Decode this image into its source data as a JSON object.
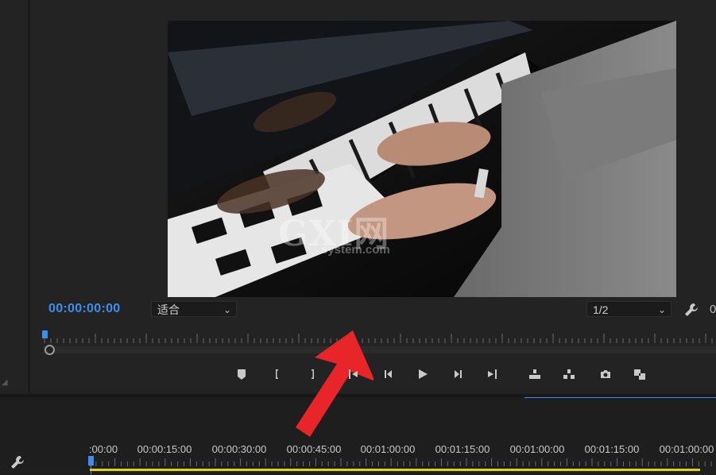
{
  "monitor": {
    "timecode": "00:00:00:00",
    "fit_dropdown": "适合",
    "resolution_dropdown": "1/2",
    "right_edge_digit": "0",
    "watermark": {
      "main": "GXI网",
      "sub": "system.com"
    }
  },
  "transport_controls": [
    {
      "name": "add-marker-button",
      "icon": "marker-icon"
    },
    {
      "name": "mark-in-button",
      "icon": "mark-in-icon"
    },
    {
      "name": "mark-out-button",
      "icon": "mark-out-icon"
    },
    {
      "name": "go-to-in-button",
      "icon": "go-to-in-icon"
    },
    {
      "name": "step-back-button",
      "icon": "step-back-icon"
    },
    {
      "name": "play-button",
      "icon": "play-icon"
    },
    {
      "name": "step-forward-button",
      "icon": "step-forward-icon"
    },
    {
      "name": "go-to-out-button",
      "icon": "go-to-out-icon"
    },
    {
      "name": "lift-button",
      "icon": "lift-icon"
    },
    {
      "name": "extract-button",
      "icon": "extract-icon"
    },
    {
      "name": "export-frame-button",
      "icon": "camera-icon"
    },
    {
      "name": "comparison-view-button",
      "icon": "comparison-view-icon"
    }
  ],
  "timeline": {
    "ruler_labels": [
      ":00:00",
      "00:00:15:00",
      "00:00:30:00",
      "00:00:45:00",
      "00:01:00:00",
      "00:01:15:00",
      "00:01:00:00",
      "00:01:15:00",
      "00:01:00:00"
    ]
  },
  "colors": {
    "accent": "#3e8ef0",
    "work_area": "#e5d400",
    "annotation_arrow": "#e8262a"
  }
}
